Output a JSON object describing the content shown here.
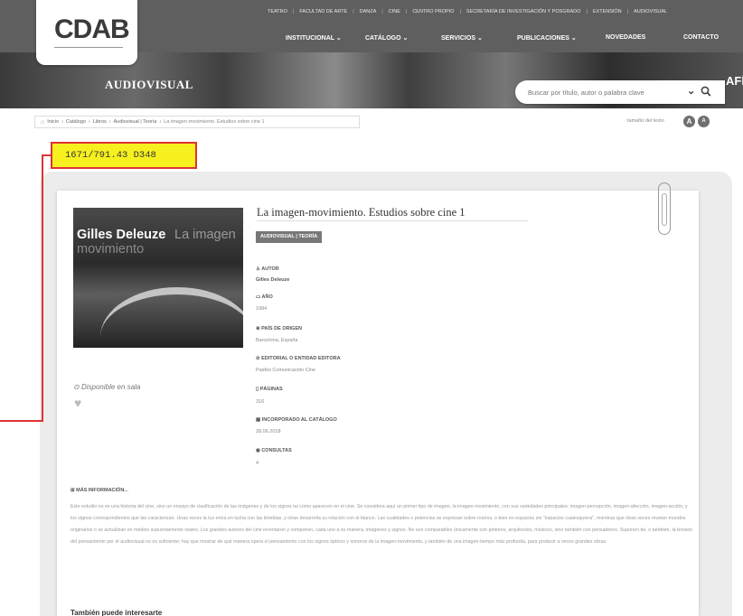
{
  "header": {
    "logo_text": "CDAB",
    "top_links": [
      "TEATRO",
      "FACULTAD DE ARTE",
      "DANZA",
      "CINE",
      "CENTRO PROPIO",
      "SECRETARÍA DE INVESTIGACIÓN Y POSGRADO",
      "EXTENSIÓN",
      "AUDIOVISUAL"
    ],
    "main_nav": [
      "INSTITUCIONAL ⌄",
      "CATÁLOGO ⌄",
      "SERVICIOS ⌄",
      "PUBLICACIONES ⌄",
      "NOVEDADES",
      "CONTACTO"
    ],
    "banner_label": "AUDIOVISUAL",
    "banner_right": "AFÍA",
    "search_placeholder": "Buscar por título, autor o palabra clave",
    "search_chevron": "⌄"
  },
  "breadcrumb": {
    "home_icon": "⌂",
    "items": [
      "Inicio",
      "Catálogo",
      "Libros",
      "Audiovisual | Teoría",
      "La imagen-movimiento. Estudios sobre cine 1"
    ],
    "separator": "›"
  },
  "text_size": {
    "label": "tamaño del texto",
    "increase": "A",
    "decrease": "A"
  },
  "call_number": "1671/791.43 D348",
  "book": {
    "title": "La imagen-movimiento. Estudios sobre cine 1",
    "tag": "AUDIOVISUAL | TEORÍA",
    "cover_author": "Gilles Deleuze",
    "cover_title": "La imagen",
    "cover_title_2": "movimiento",
    "availability": "Disponible en sala",
    "fields": [
      {
        "label": "AUTOR",
        "value": "Gilles Deleuze",
        "bold": true
      },
      {
        "label": "AÑO",
        "value": "1984"
      },
      {
        "label": "PAÍS DE ORIGEN",
        "value": "Barcelona, España"
      },
      {
        "label": "EDITORIAL O ENTIDAD EDITORA",
        "value": "Paidós Comunicación Cine"
      },
      {
        "label": "PÁGINAS",
        "value": "316"
      },
      {
        "label": "INCORPORADO AL CATÁLOGO",
        "value": "28.06.2018"
      },
      {
        "label": "CONSULTAS",
        "value": "4"
      }
    ]
  },
  "more_info": {
    "label": "MÁS INFORMACIÓN...",
    "text": "Este estudio no es una historia del cine, sino un ensayo de clasificación de las imágenes y de los signos tal como aparecen en el cine. Se considera aquí un primer tipo de imagen, la imagen-movimiento, con sus variedades principales: imagen-percepción, imagen-afección, imagen-acción, y los signos correspondientes que las caracterizan. Unas veces la luz entra en lucha con las tinieblas, y otras desarrolla su relación con el blanco. Las cualidades o potencias se expresan sobre rostros, o bien en espacios sin \"espacios cualesquiera\", mientras que otras veces revelan mundos originarios o se actualizan en medios supuestamente reales. Los grandes autores del cine inventaron y componen, cada uno a su manera, imágenes y signos. No son comparables únicamente con pintores, arquitectos, músicos, sino también con pensadores. Suponen de, o también, la tensión del pensamiento por el audiovisual no es suficiente; hay que mostrar de qué manera opera el pensamiento con los signos ópticos y sonoros de la imagen-movimiento, y también de una imagen-tiempo más profunda, para producir a veces grandes obras."
  },
  "related_heading": "También puede interesarte"
}
